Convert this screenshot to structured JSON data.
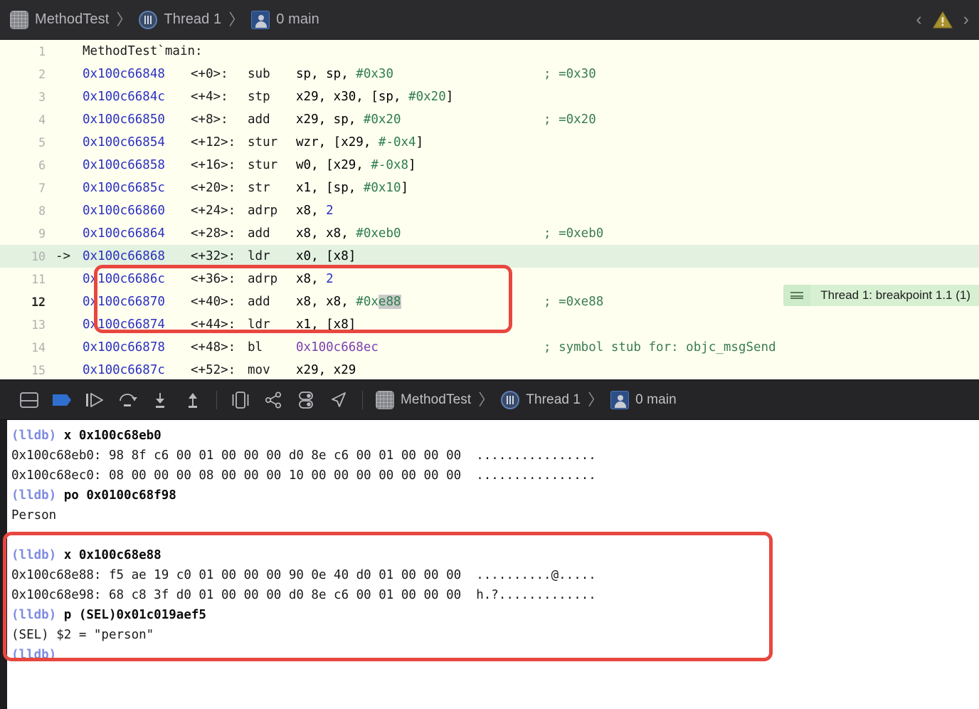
{
  "jump_bar": {
    "crumbs": [
      {
        "icon": "project-icon",
        "label": "MethodTest"
      },
      {
        "icon": "thread-icon",
        "label": "Thread 1"
      },
      {
        "icon": "person-icon",
        "label": "0 main"
      }
    ],
    "separator": "〉",
    "nav_back": "‹",
    "nav_forward": "›",
    "warning_icon": "warning-triangle-icon"
  },
  "editor": {
    "header_line": {
      "num": "1",
      "text": "MethodTest`main:"
    },
    "rows": [
      {
        "num": "2",
        "arrow": "",
        "addr": "0x100c66848",
        "off": "<+0>:",
        "mnem": "sub",
        "ops": "sp, sp, #0x30",
        "imm": "#0x30",
        "cmt": "; =0x30"
      },
      {
        "num": "3",
        "arrow": "",
        "addr": "0x100c6684c",
        "off": "<+4>:",
        "mnem": "stp",
        "ops": "x29, x30, [sp, #0x20]",
        "imm": "#0x20",
        "cmt": ""
      },
      {
        "num": "4",
        "arrow": "",
        "addr": "0x100c66850",
        "off": "<+8>:",
        "mnem": "add",
        "ops": "x29, sp, #0x20",
        "imm": "#0x20",
        "cmt": "; =0x20"
      },
      {
        "num": "5",
        "arrow": "",
        "addr": "0x100c66854",
        "off": "<+12>:",
        "mnem": "stur",
        "ops": "wzr, [x29, #-0x4]",
        "imm": "#-0x4",
        "cmt": ""
      },
      {
        "num": "6",
        "arrow": "",
        "addr": "0x100c66858",
        "off": "<+16>:",
        "mnem": "stur",
        "ops": "w0, [x29, #-0x8]",
        "imm": "#-0x8",
        "cmt": ""
      },
      {
        "num": "7",
        "arrow": "",
        "addr": "0x100c6685c",
        "off": "<+20>:",
        "mnem": "str",
        "ops": "x1, [sp, #0x10]",
        "imm": "#0x10",
        "cmt": ""
      },
      {
        "num": "8",
        "arrow": "",
        "addr": "0x100c66860",
        "off": "<+24>:",
        "mnem": "adrp",
        "ops": "x8, 2",
        "imm": "2",
        "cmt": ""
      },
      {
        "num": "9",
        "arrow": "",
        "addr": "0x100c66864",
        "off": "<+28>:",
        "mnem": "add",
        "ops": "x8, x8, #0xeb0",
        "imm": "#0xeb0",
        "cmt": "; =0xeb0"
      },
      {
        "num": "10",
        "arrow": "->",
        "addr": "0x100c66868",
        "off": "<+32>:",
        "mnem": "ldr",
        "ops": "x0, [x8]",
        "imm": "",
        "cmt": ""
      },
      {
        "num": "11",
        "arrow": "",
        "addr": "0x100c6686c",
        "off": "<+36>:",
        "mnem": "adrp",
        "ops": "x8, 2",
        "imm": "2",
        "cmt": ""
      },
      {
        "num": "12",
        "arrow": "",
        "addr": "0x100c66870",
        "off": "<+40>:",
        "mnem": "add",
        "ops": "x8, x8, #0xe88",
        "imm": "#0xe88",
        "cmt": "; =0xe88"
      },
      {
        "num": "13",
        "arrow": "",
        "addr": "0x100c66874",
        "off": "<+44>:",
        "mnem": "ldr",
        "ops": "x1, [x8]",
        "imm": "",
        "cmt": ""
      },
      {
        "num": "14",
        "arrow": "",
        "addr": "0x100c66878",
        "off": "<+48>:",
        "mnem": "bl",
        "ops": "0x100c668ec",
        "imm": "",
        "cmt": "; symbol stub for: objc_msgSend"
      },
      {
        "num": "15",
        "arrow": "",
        "addr": "0x100c6687c",
        "off": "<+52>:",
        "mnem": "mov",
        "ops": "x29, x29",
        "imm": "",
        "cmt": ""
      }
    ],
    "current_line_num": "10",
    "cursor_line_num": "12",
    "selected_text": "e88",
    "breakpoint_badge": {
      "handle_icon": "hamburger-icon",
      "label": "Thread 1: breakpoint 1.1 (1)"
    }
  },
  "debug_toolbar": {
    "buttons": [
      {
        "name": "toggle-debug-area-button",
        "icon": "panel-split-icon"
      },
      {
        "name": "breakpoints-toggle-button",
        "icon": "breakpoint-arrow-icon",
        "active": true
      },
      {
        "name": "continue-button",
        "icon": "continue-play-icon"
      },
      {
        "name": "step-over-button",
        "icon": "step-over-icon"
      },
      {
        "name": "step-into-button",
        "icon": "step-into-icon"
      },
      {
        "name": "step-out-button",
        "icon": "step-out-icon"
      },
      {
        "name": "debug-view-hierarchy-button",
        "icon": "view-hierarchy-icon"
      },
      {
        "name": "debug-memory-graph-button",
        "icon": "memory-graph-icon"
      },
      {
        "name": "environment-overrides-button",
        "icon": "environment-overrides-icon"
      },
      {
        "name": "simulate-location-button",
        "icon": "location-arrow-icon"
      }
    ],
    "crumbs": [
      {
        "icon": "project-icon",
        "label": "MethodTest"
      },
      {
        "icon": "thread-icon",
        "label": "Thread 1"
      },
      {
        "icon": "person-icon",
        "label": "0 main"
      }
    ],
    "separator": "〉",
    "accent_color": "#2f6fd0"
  },
  "console": {
    "lines": [
      {
        "type": "command",
        "prompt": "(lldb)",
        "text": " x 0x100c68eb0"
      },
      {
        "type": "output",
        "text": "0x100c68eb0: 98 8f c6 00 01 00 00 00 d0 8e c6 00 01 00 00 00  ................"
      },
      {
        "type": "output",
        "text": "0x100c68ec0: 08 00 00 00 08 00 00 00 10 00 00 00 00 00 00 00  ................"
      },
      {
        "type": "command",
        "prompt": "(lldb)",
        "text": " po 0x0100c68f98"
      },
      {
        "type": "output",
        "text": "Person"
      },
      {
        "type": "blank",
        "text": ""
      },
      {
        "type": "command",
        "prompt": "(lldb)",
        "text": " x 0x100c68e88"
      },
      {
        "type": "output",
        "text": "0x100c68e88: f5 ae 19 c0 01 00 00 00 90 0e 40 d0 01 00 00 00  ..........@....."
      },
      {
        "type": "output",
        "text": "0x100c68e98: 68 c8 3f d0 01 00 00 00 d0 8e c6 00 01 00 00 00  h.?............."
      },
      {
        "type": "command",
        "prompt": "(lldb)",
        "text": " p (SEL)0x01c019aef5"
      },
      {
        "type": "output",
        "text": "(SEL) $2 = \"person\""
      },
      {
        "type": "command",
        "prompt": "(lldb)",
        "text": ""
      }
    ]
  },
  "annotations": {
    "color": "#e8473f",
    "boxes": [
      {
        "name": "assembly-highlight-box"
      },
      {
        "name": "console-highlight-box"
      }
    ]
  },
  "colors": {
    "editor_bg": "#fffff0",
    "current_line_bg": "#e2f1e0",
    "address": "#2b30c0",
    "immediate": "#2e7d4f",
    "comment": "#3a7d52",
    "branch_target": "#7a3fb0",
    "prompt": "#7f8be0",
    "annotation_red": "#e8473f"
  }
}
